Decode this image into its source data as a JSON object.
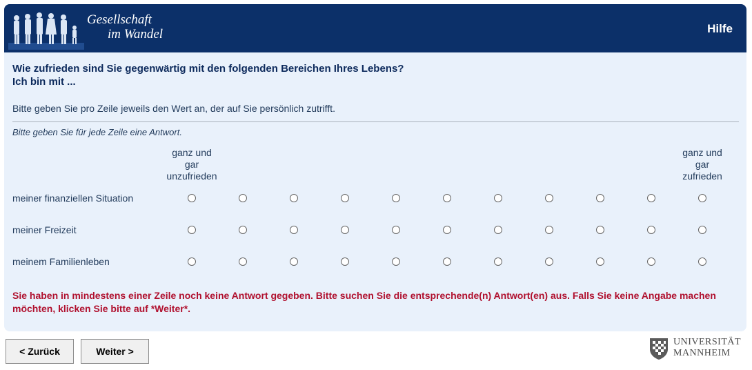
{
  "header": {
    "brand_line1": "Gesellschaft",
    "brand_line2": "im Wandel",
    "help_label": "Hilfe",
    "colors": {
      "header_bg": "#0c3069",
      "panel_bg": "#e9f1fb"
    }
  },
  "question": {
    "title_line1": "Wie zufrieden sind Sie gegenwärtig mit den folgenden Bereichen Ihres Lebens?",
    "title_line2": "Ich bin mit ...",
    "instruction": "Bitte geben Sie pro Zeile jeweils den Wert an, der auf Sie persönlich zutrifft.",
    "instruction_italic": "Bitte geben Sie für jede Zeile eine Antwort.",
    "anchor_left": [
      "ganz und",
      "gar",
      "unzufrieden"
    ],
    "anchor_right": [
      "ganz und",
      "gar",
      "zufrieden"
    ],
    "scale_points": 11,
    "rows": [
      {
        "label": "meiner finanziellen Situation",
        "selected": null
      },
      {
        "label": "meiner Freizeit",
        "selected": null
      },
      {
        "label": "meinem Familienleben",
        "selected": null
      }
    ],
    "error": "Sie haben in mindestens einer Zeile noch keine Antwort gegeben. Bitte suchen Sie die entsprechende(n) Antwort(en) aus. Falls Sie keine Angabe machen möchten, klicken Sie bitte auf *Weiter*."
  },
  "nav": {
    "back_label": "< Zurück",
    "next_label": "Weiter >"
  },
  "university": {
    "line1": "UNIVERSITÄT",
    "line2": "MANNHEIM"
  }
}
